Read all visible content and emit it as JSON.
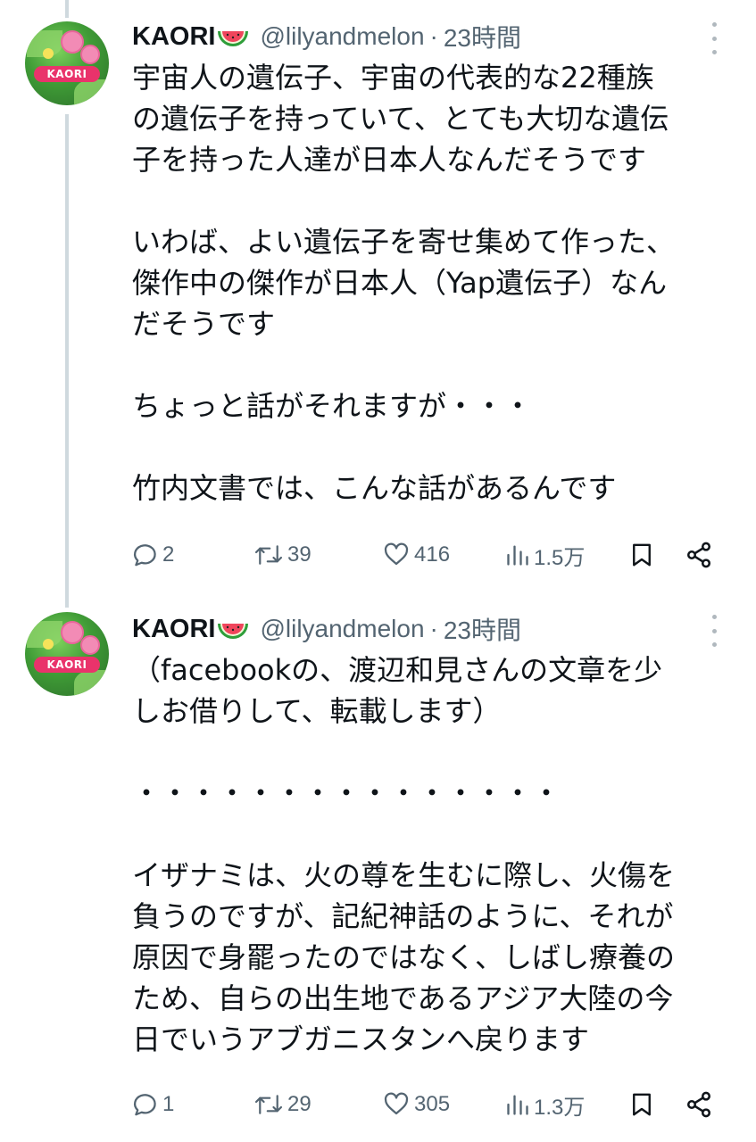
{
  "tweets": [
    {
      "display_name": "KAORI",
      "handle": "@lilyandmelon",
      "separator": "·",
      "time": "23時間",
      "avatar_text": "KAORI",
      "body": "宇宙人の遺伝子、宇宙の代表的な22種族\nの遺伝子を持っていて、とても大切な遺伝\n子を持った人達が日本人なんだそうです\n\nいわば、よい遺伝子を寄せ集めて作った、\n傑作中の傑作が日本人（Yap遺伝子）なん\nだそうです\n\nちょっと話がそれますが・・・\n\n竹内文書では、こんな話があるんです",
      "reply_count": "2",
      "retweet_count": "39",
      "like_count": "416",
      "view_count": "1.5万"
    },
    {
      "display_name": "KAORI",
      "handle": "@lilyandmelon",
      "separator": "·",
      "time": "23時間",
      "avatar_text": "KAORI",
      "body": "（facebookの、渡辺和見さんの文章を少\nしお借りして、転載します）\n\n・・・・・・・・・・・・・・・\n\nイザナミは、火の尊を生むに際し、火傷を\n負うのですが、記紀神話のように、それが\n原因で身罷ったのではなく、しばし療養の\nため、自らの出生地であるアジア大陸の今\n日でいうアブガニスタンへ戻ります",
      "reply_count": "1",
      "retweet_count": "29",
      "like_count": "305",
      "view_count": "1.3万"
    }
  ],
  "icons": {
    "name_emoji": "watermelon-icon",
    "more": "more-vertical-icon",
    "reply": "reply-icon",
    "retweet": "retweet-icon",
    "like": "heart-icon",
    "views": "views-icon",
    "bookmark": "bookmark-icon",
    "share": "share-icon"
  },
  "colors": {
    "text_primary": "#0f1419",
    "text_secondary": "#536471",
    "thread_line": "#cfd9de",
    "avatar_badge": "#e9336b"
  }
}
